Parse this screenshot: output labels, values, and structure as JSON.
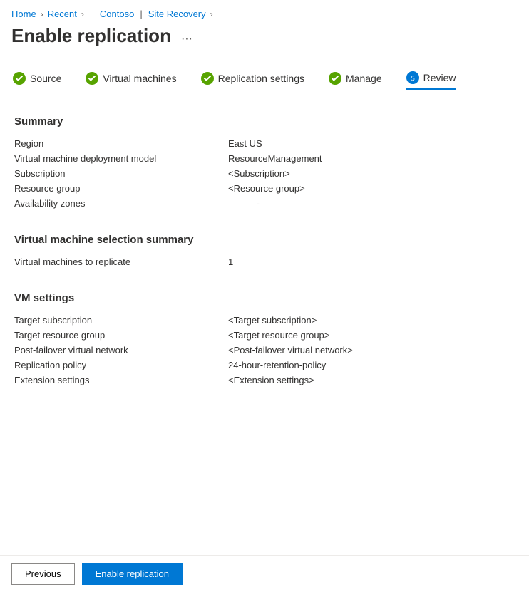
{
  "breadcrumb": {
    "home": "Home",
    "recent": "Recent",
    "contoso": "Contoso",
    "service": "Site Recovery"
  },
  "page": {
    "title": "Enable replication"
  },
  "steps": {
    "source": "Source",
    "vms": "Virtual machines",
    "replication": "Replication settings",
    "manage": "Manage",
    "review_number": "5",
    "review": "Review"
  },
  "summary": {
    "title": "Summary",
    "region_label": "Region",
    "region_value": "East US",
    "model_label": "Virtual machine deployment model",
    "model_value": "ResourceManagement",
    "subscription_label": "Subscription",
    "subscription_value": "<Subscription>",
    "rg_label": "Resource group",
    "rg_value": "<Resource group>",
    "az_label": "Availability zones",
    "az_value": "-"
  },
  "vm_selection": {
    "title": "Virtual machine selection summary",
    "vms_label": "Virtual machines to replicate",
    "vms_value": "1"
  },
  "vm_settings": {
    "title": "VM settings",
    "target_sub_label": "Target subscription",
    "target_sub_value": "<Target subscription>",
    "target_rg_label": "Target resource group",
    "target_rg_value": "<Target resource group>",
    "vnet_label": "Post-failover virtual network",
    "vnet_value": "<Post-failover virtual network>",
    "policy_label": "Replication policy",
    "policy_value": "24-hour-retention-policy",
    "ext_label": "Extension settings",
    "ext_value": "<Extension settings>"
  },
  "footer": {
    "previous": "Previous",
    "enable": "Enable replication"
  }
}
